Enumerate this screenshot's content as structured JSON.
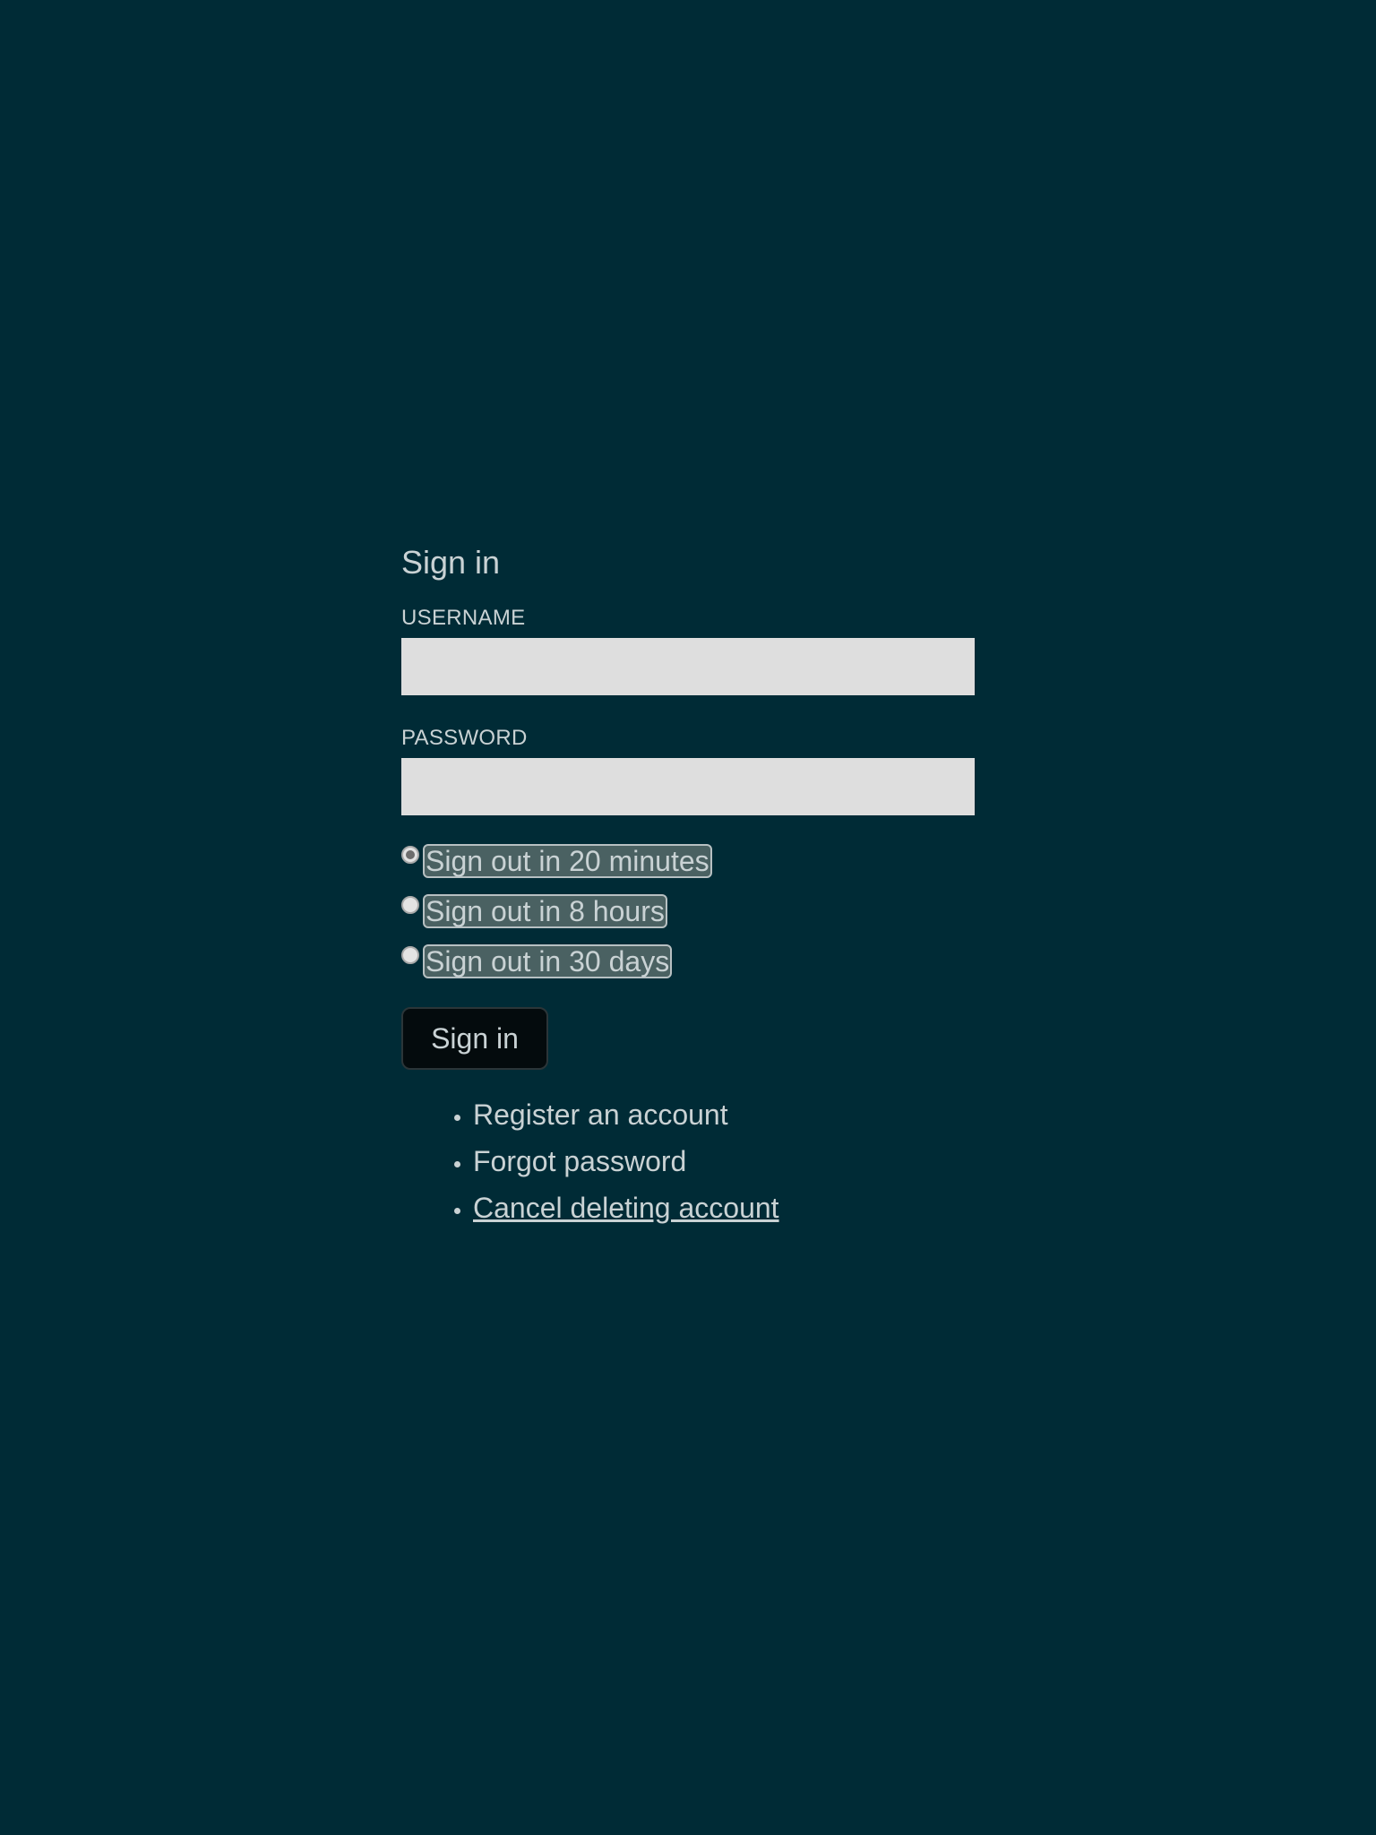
{
  "form": {
    "title": "Sign in",
    "username_label": "USERNAME",
    "username_value": "",
    "password_label": "PASSWORD",
    "password_value": "",
    "signout_options": [
      {
        "label": "Sign out in 20 minutes",
        "checked": true
      },
      {
        "label": "Sign out in 8 hours",
        "checked": false
      },
      {
        "label": "Sign out in 30 days",
        "checked": false
      }
    ],
    "submit_label": "Sign in"
  },
  "links": [
    {
      "label": "Register an account",
      "underlined": false
    },
    {
      "label": "Forgot password",
      "underlined": false
    },
    {
      "label": "Cancel deleting account",
      "underlined": true
    }
  ],
  "colors": {
    "background": "#002b36",
    "text": "#c9d2d4",
    "input_background": "#dedede",
    "radio_label_background": "#4a6162",
    "button_background": "#040b0d"
  }
}
